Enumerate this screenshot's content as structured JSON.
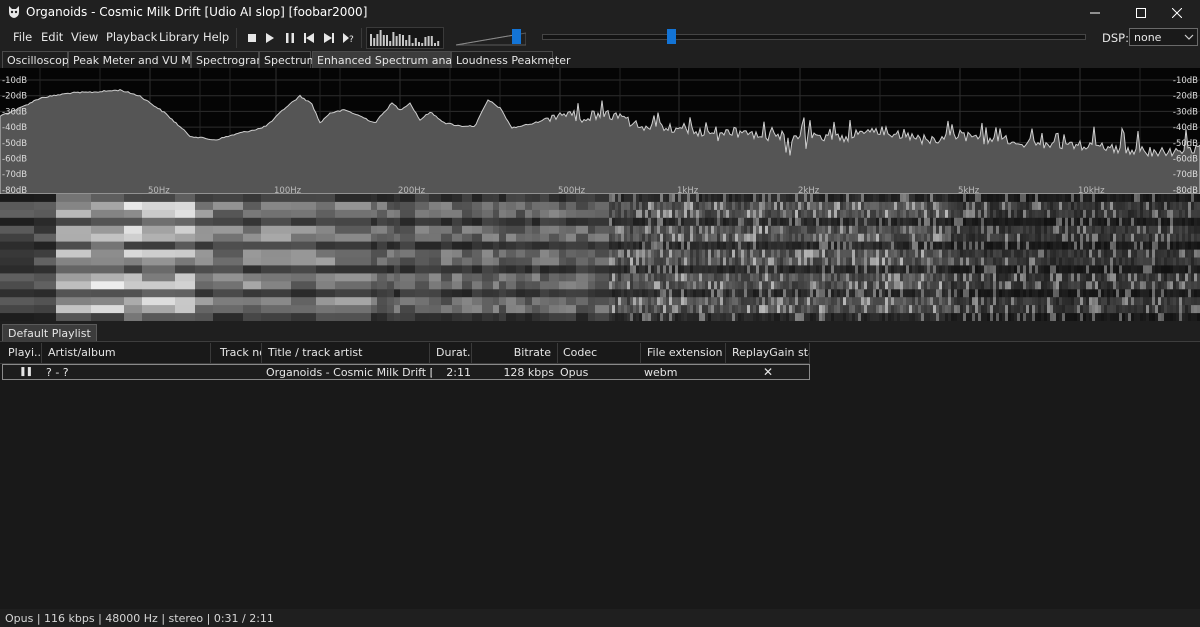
{
  "window": {
    "title": "Organoids - Cosmic Milk Drift [Udio AI slop]  [foobar2000]",
    "icon": "foobar-app-icon"
  },
  "menu": [
    "File",
    "Edit",
    "View",
    "Playback",
    "Library",
    "Help"
  ],
  "toolbar": {
    "buttons": [
      "stop-icon",
      "play-icon",
      "pause-icon",
      "previous-icon",
      "next-icon",
      "random-icon"
    ],
    "volume_level": 0.85,
    "seek_position": 0.237,
    "dsp_label": "DSP:",
    "dsp_value": "none"
  },
  "vis_tabs": [
    "Oscilloscope",
    "Peak Meter and VU Meter",
    "Spectrogram",
    "Spectrum",
    "Enhanced Spectrum analyzer",
    "Loudness Peakmeter"
  ],
  "active_vis_tab": "Enhanced Spectrum analyzer",
  "spectrum": {
    "db_labels": [
      "-10dB",
      "-20dB",
      "-30dB",
      "-40dB",
      "-50dB",
      "-60dB",
      "-70dB",
      "-80dB"
    ],
    "freq_labels": [
      "50Hz",
      "100Hz",
      "200Hz",
      "500Hz",
      "1kHz",
      "2kHz",
      "5kHz",
      "10kHz"
    ]
  },
  "playlist_tabs": [
    "Default Playlist"
  ],
  "playlist": {
    "columns": [
      "Playi...",
      "Artist/album",
      "Track no",
      "Title / track artist",
      "Durat...",
      "Bitrate",
      "Codec",
      "File extension",
      "ReplayGain sta..."
    ],
    "rows": [
      {
        "playing": "❚❚",
        "artist_album": "? - ?",
        "track_no": "",
        "title": "Organoids - Cosmic Milk Drift [Udi...",
        "duration": "2:11",
        "bitrate": "128 kbps",
        "codec": "Opus",
        "extension": "webm",
        "replaygain": "✕"
      }
    ]
  },
  "status": "Opus | 116 kbps | 48000 Hz | stereo | 0:31 / 2:11",
  "colors": {
    "accent": "#1374d6",
    "background": "#1f1f1f",
    "playlist_bg": "#191919"
  }
}
